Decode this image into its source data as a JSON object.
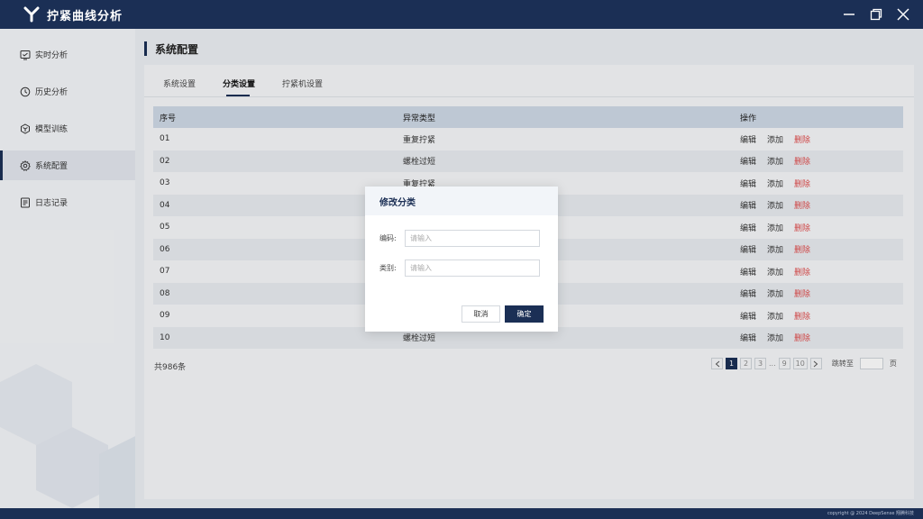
{
  "app": {
    "title": "拧紧曲线分析"
  },
  "sidebar": {
    "items": [
      {
        "label": "实时分析",
        "icon": "monitor-icon"
      },
      {
        "label": "历史分析",
        "icon": "history-clock-icon"
      },
      {
        "label": "模型训练",
        "icon": "model-hexagon-icon"
      },
      {
        "label": "系统配置",
        "icon": "gear-icon",
        "active": true
      },
      {
        "label": "日志记录",
        "icon": "log-document-icon"
      }
    ]
  },
  "page": {
    "title": "系统配置"
  },
  "tabs": [
    {
      "label": "系统设置"
    },
    {
      "label": "分类设置",
      "active": true
    },
    {
      "label": "拧紧机设置"
    }
  ],
  "table": {
    "headers": [
      "序号",
      "异常类型",
      "操作"
    ],
    "rows": [
      {
        "id": "01",
        "type": "重复拧紧"
      },
      {
        "id": "02",
        "type": "螺栓过短"
      },
      {
        "id": "03",
        "type": "重复拧紧"
      },
      {
        "id": "04",
        "type": ""
      },
      {
        "id": "05",
        "type": ""
      },
      {
        "id": "06",
        "type": ""
      },
      {
        "id": "07",
        "type": ""
      },
      {
        "id": "08",
        "type": ""
      },
      {
        "id": "09",
        "type": ""
      },
      {
        "id": "10",
        "type": "螺栓过短"
      }
    ],
    "actions": {
      "edit": "编辑",
      "add": "添加",
      "delete": "删除"
    }
  },
  "pagination": {
    "total": "共986条",
    "pages": [
      "1",
      "2",
      "3"
    ],
    "ellipsis": "...",
    "tail_pages": [
      "9",
      "10"
    ],
    "current": "1",
    "jump_label": "跳转至",
    "jump_suffix": "页"
  },
  "dialog": {
    "title": "修改分类",
    "fields": [
      {
        "label": "编码:",
        "placeholder": "请输入"
      },
      {
        "label": "类别:",
        "placeholder": "请输入"
      }
    ],
    "cancel_label": "取消",
    "ok_label": "确定"
  },
  "footer": {
    "copyright": "copyright @ 2024 DeepSense 翔腾科技"
  },
  "colors": {
    "primary": "#1b2f55",
    "danger": "#e04a4a",
    "table_header": "#cfd9e6"
  }
}
